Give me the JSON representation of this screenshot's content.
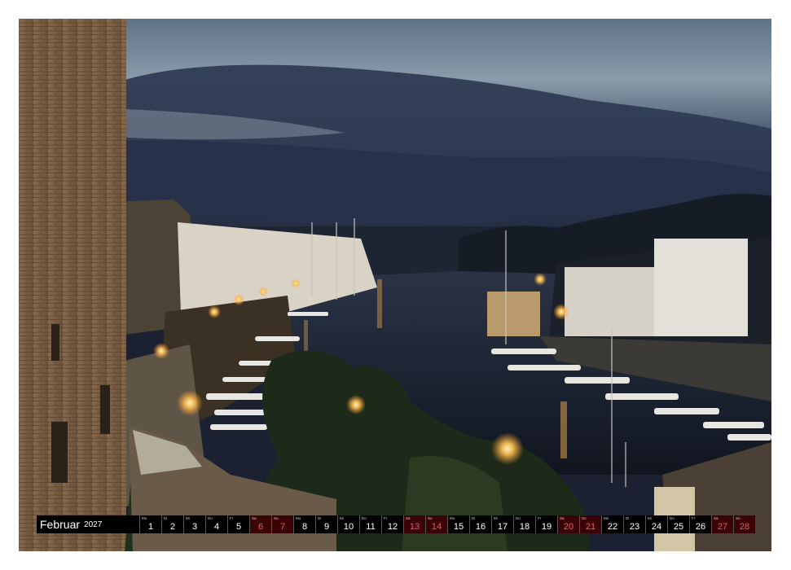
{
  "calendar": {
    "month": "Februar",
    "year": "2027",
    "days": [
      {
        "wd": "Mo",
        "num": "1",
        "weekend": false
      },
      {
        "wd": "Di",
        "num": "2",
        "weekend": false
      },
      {
        "wd": "Mi",
        "num": "3",
        "weekend": false
      },
      {
        "wd": "Do",
        "num": "4",
        "weekend": false
      },
      {
        "wd": "Fr",
        "num": "5",
        "weekend": false
      },
      {
        "wd": "Sa",
        "num": "6",
        "weekend": true
      },
      {
        "wd": "So",
        "num": "7",
        "weekend": true
      },
      {
        "wd": "Mo",
        "num": "8",
        "weekend": false
      },
      {
        "wd": "Di",
        "num": "9",
        "weekend": false
      },
      {
        "wd": "Mi",
        "num": "10",
        "weekend": false
      },
      {
        "wd": "Do",
        "num": "11",
        "weekend": false
      },
      {
        "wd": "Fr",
        "num": "12",
        "weekend": false
      },
      {
        "wd": "Sa",
        "num": "13",
        "weekend": true
      },
      {
        "wd": "So",
        "num": "14",
        "weekend": true
      },
      {
        "wd": "Mo",
        "num": "15",
        "weekend": false
      },
      {
        "wd": "Di",
        "num": "16",
        "weekend": false
      },
      {
        "wd": "Mi",
        "num": "17",
        "weekend": false
      },
      {
        "wd": "Do",
        "num": "18",
        "weekend": false
      },
      {
        "wd": "Fr",
        "num": "19",
        "weekend": false
      },
      {
        "wd": "Sa",
        "num": "20",
        "weekend": true
      },
      {
        "wd": "So",
        "num": "21",
        "weekend": true
      },
      {
        "wd": "Mo",
        "num": "22",
        "weekend": false
      },
      {
        "wd": "Di",
        "num": "23",
        "weekend": false
      },
      {
        "wd": "Mi",
        "num": "24",
        "weekend": false
      },
      {
        "wd": "Do",
        "num": "25",
        "weekend": false
      },
      {
        "wd": "Fr",
        "num": "26",
        "weekend": false
      },
      {
        "wd": "Sa",
        "num": "27",
        "weekend": true
      },
      {
        "wd": "So",
        "num": "28",
        "weekend": true
      }
    ]
  },
  "photo": {
    "subject": "harbor-at-dusk"
  },
  "colors": {
    "bar_background": "#000000",
    "weekend_cell": "#3a0406",
    "weekend_text": "#ee5a5a",
    "weekday_text": "#ffffff"
  }
}
